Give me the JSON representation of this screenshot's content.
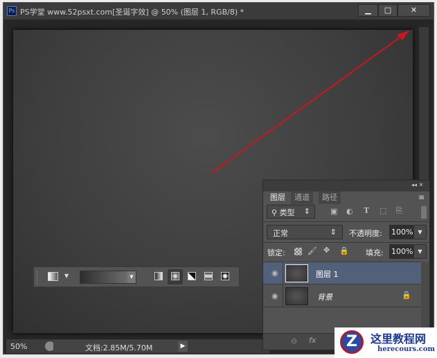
{
  "window": {
    "title": "PS学堂 www.52psxt.com[圣诞字效] @ 50% (图层 1, RGB/8) *",
    "app_icon": "Ps",
    "minimize": "▁",
    "maximize": "□",
    "close": "✕"
  },
  "status": {
    "zoom": "50%",
    "doc_info": "文档:2.85M/5.70M"
  },
  "layers_panel": {
    "tabs": [
      "图层",
      "通道",
      "路径"
    ],
    "filter": {
      "label": "类型"
    },
    "blend_mode": "正常",
    "opacity_label": "不透明度:",
    "opacity": "100%",
    "lock_label": "锁定:",
    "fill_label": "填充:",
    "fill": "100%",
    "layers": [
      {
        "name": "图层 1",
        "selected": true
      },
      {
        "name": "背景",
        "locked": true
      }
    ],
    "footer": {
      "link": "⊖",
      "fx": "fx"
    }
  },
  "watermark": {
    "name": "这里教程网",
    "url": "herecours.com"
  },
  "colors": {
    "arrow": "#d0141c",
    "selected_layer": "#52607a"
  }
}
